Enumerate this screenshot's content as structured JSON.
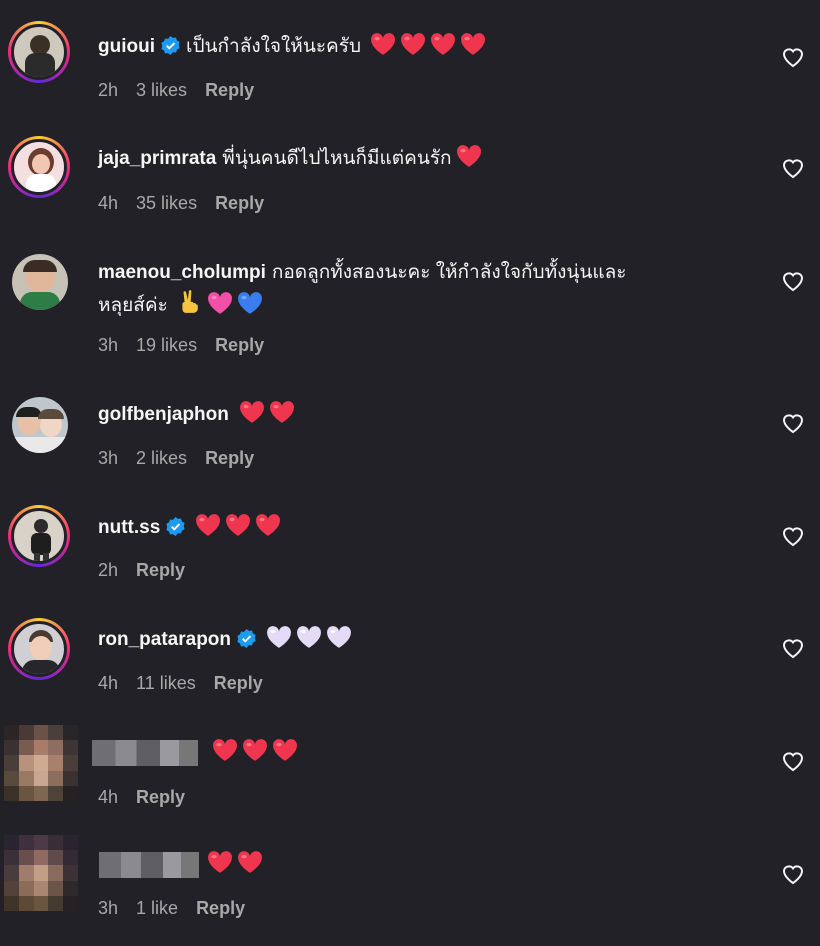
{
  "colors": {
    "background": "#212127",
    "meta_text": "#a8a8a8",
    "heart_red": "#f0364f",
    "heart_pink": "#f24fa6",
    "heart_blue": "#3b7df1",
    "heart_white": "#e4dcf7",
    "verified_blue": "#1d9bf0"
  },
  "comments": [
    {
      "username": "guioui",
      "verified": true,
      "text": "เป็นกำลังใจให้นะครับ",
      "emojis": [
        "heart-red",
        "heart-red",
        "heart-red",
        "heart-red"
      ],
      "time": "2h",
      "likes": "3 likes",
      "reply": "Reply"
    },
    {
      "username": "jaja_primrata",
      "verified": false,
      "text": "พี่นุ่นคนดีไปไหนก็มีแต่คนรัก",
      "emojis": [
        "heart-red"
      ],
      "time": "4h",
      "likes": "35 likes",
      "reply": "Reply"
    },
    {
      "username": "maenou_cholumpi",
      "verified": false,
      "text": "กอดลูกทั้งสองนะคะ ให้กำลังใจกับทั้งนุ่นและ",
      "text_line2": "หลุยส์ค่ะ",
      "emojis": [
        "victory-hand",
        "heart-pink",
        "heart-blue"
      ],
      "time": "3h",
      "likes": "19 likes",
      "reply": "Reply"
    },
    {
      "username": "golfbenjaphon",
      "verified": false,
      "text": "",
      "emojis": [
        "heart-red",
        "heart-red"
      ],
      "time": "3h",
      "likes": "2 likes",
      "reply": "Reply"
    },
    {
      "username": "nutt.ss",
      "verified": true,
      "text": "",
      "emojis": [
        "heart-red",
        "heart-red",
        "heart-red"
      ],
      "time": "2h",
      "likes": "",
      "reply": "Reply"
    },
    {
      "username": "ron_patarapon",
      "verified": true,
      "text": "",
      "emojis": [
        "heart-white",
        "heart-white",
        "heart-white"
      ],
      "time": "4h",
      "likes": "11 likes",
      "reply": "Reply"
    },
    {
      "username": "",
      "blurred": true,
      "verified": false,
      "text": "",
      "emojis": [
        "heart-red",
        "heart-red",
        "heart-red"
      ],
      "time": "4h",
      "likes": "",
      "reply": "Reply"
    },
    {
      "username": "",
      "blurred": true,
      "verified": false,
      "text": "",
      "emojis": [
        "heart-red",
        "heart-red"
      ],
      "time": "3h",
      "likes": "1 like",
      "reply": "Reply"
    }
  ]
}
